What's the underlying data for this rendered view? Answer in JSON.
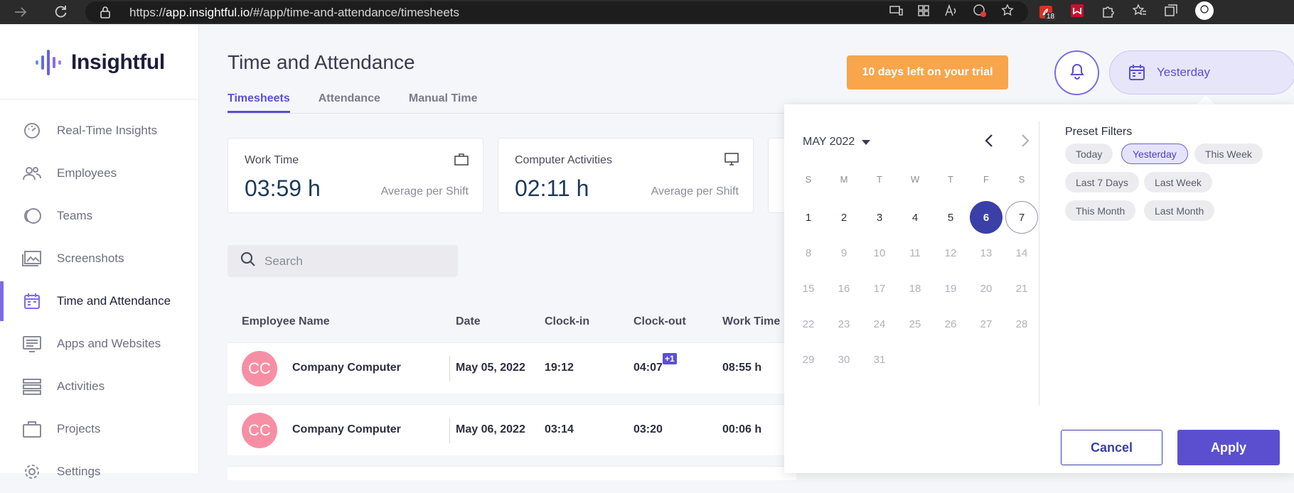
{
  "browser": {
    "url_scheme": "https://",
    "url_host": "app.insightful.io",
    "url_path": "/#/app/time-and-attendance/timesheets",
    "badge_count": "18"
  },
  "app": {
    "logo_text": "Insightful",
    "brand_color": "#5b4fd0"
  },
  "sidebar": {
    "items": [
      {
        "label": "Real-Time Insights",
        "icon": "speedometer-icon"
      },
      {
        "label": "Employees",
        "icon": "people-icon"
      },
      {
        "label": "Teams",
        "icon": "teams-icon"
      },
      {
        "label": "Screenshots",
        "icon": "images-icon"
      },
      {
        "label": "Time and Attendance",
        "icon": "calendar-icon",
        "active": true
      },
      {
        "label": "Apps and Websites",
        "icon": "monitor-list-icon"
      },
      {
        "label": "Activities",
        "icon": "activities-icon"
      },
      {
        "label": "Projects",
        "icon": "briefcase-icon"
      },
      {
        "label": "Settings",
        "icon": "gear-icon"
      }
    ]
  },
  "header": {
    "title": "Time and Attendance",
    "tabs": [
      {
        "label": "Timesheets",
        "active": true
      },
      {
        "label": "Attendance"
      },
      {
        "label": "Manual Time"
      }
    ],
    "trial_text": "10 days left on your trial",
    "date_button": "Yesterday"
  },
  "cards": [
    {
      "title": "Work Time",
      "value": "03:59 h",
      "sub": "Average per Shift",
      "icon": "briefcase-icon"
    },
    {
      "title": "Computer Activities",
      "value": "02:11 h",
      "sub": "Average per Shift",
      "icon": "monitor-icon"
    }
  ],
  "search": {
    "placeholder": "Search"
  },
  "table": {
    "headers": [
      "Employee Name",
      "Date",
      "Clock-in",
      "Clock-out",
      "Work Time"
    ],
    "rows": [
      {
        "initials": "CC",
        "name": "Company Computer",
        "date": "May 05, 2022",
        "clock_in": "19:12",
        "clock_out": "04:07",
        "badge": "+1",
        "work_time": "08:55 h"
      },
      {
        "initials": "CC",
        "name": "Company Computer",
        "date": "May 06, 2022",
        "clock_in": "03:14",
        "clock_out": "03:20",
        "badge": "",
        "work_time": "00:06 h"
      }
    ]
  },
  "datepicker": {
    "month_label": "MAY 2022",
    "weekdays": [
      "S",
      "M",
      "T",
      "W",
      "T",
      "F",
      "S"
    ],
    "days": [
      "1",
      "2",
      "3",
      "4",
      "5",
      "6",
      "7",
      "8",
      "9",
      "10",
      "11",
      "12",
      "13",
      "14",
      "15",
      "16",
      "17",
      "18",
      "19",
      "20",
      "21",
      "22",
      "23",
      "24",
      "25",
      "26",
      "27",
      "28",
      "29",
      "30",
      "31"
    ],
    "selected_day": "6",
    "today_day": "7",
    "preset_title": "Preset Filters",
    "presets": [
      "Today",
      "Yesterday",
      "This Week",
      "Last 7 Days",
      "Last Week",
      "This Month",
      "Last Month"
    ],
    "active_preset": "Yesterday",
    "cancel_label": "Cancel",
    "apply_label": "Apply"
  }
}
